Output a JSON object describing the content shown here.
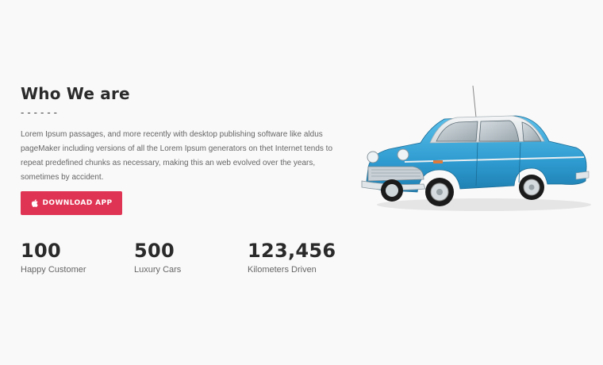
{
  "about": {
    "title": "Who We are",
    "dashes": "------",
    "description": "Lorem Ipsum passages, and more recently with desktop publishing software like aldus pageMaker including versions of all the Lorem Ipsum generators on thet Internet tends to repeat predefined chunks as necessary, making this an web evolved over the years, sometimes by accident.",
    "download_button": {
      "icon": "apple-icon",
      "label": "DOWNLOAD APP"
    },
    "car_image": "vintage-blue-car-image"
  },
  "stats": [
    {
      "value": "100",
      "label": "Happy Customer"
    },
    {
      "value": "500",
      "label": "Luxury Cars"
    },
    {
      "value": "123,456",
      "label": "Kilometers Driven"
    }
  ],
  "colors": {
    "accent": "#e03454",
    "background": "#f9f9f9",
    "heading": "#2a2a2a",
    "body_text": "#666666",
    "car_blue": "#3aa6d8"
  }
}
